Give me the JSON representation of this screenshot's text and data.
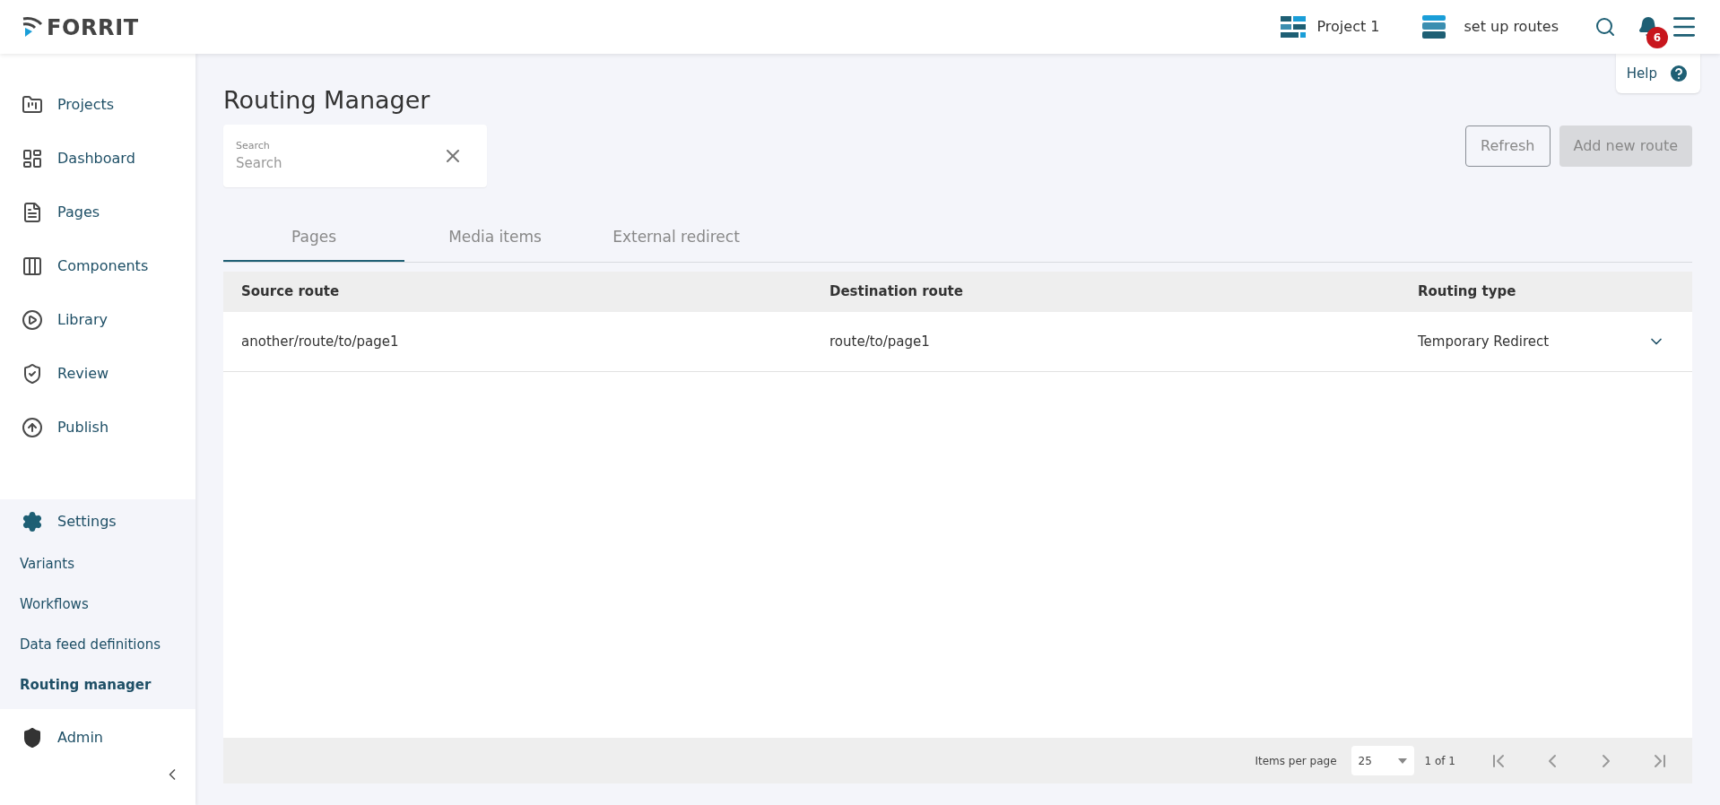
{
  "logo": {
    "text": "FORRIT"
  },
  "header": {
    "project": "Project 1",
    "workflow": "set up routes",
    "notifications": "6"
  },
  "help": {
    "label": "Help"
  },
  "sidebar": {
    "items": [
      {
        "label": "Projects"
      },
      {
        "label": "Dashboard"
      },
      {
        "label": "Pages"
      },
      {
        "label": "Components"
      },
      {
        "label": "Library"
      },
      {
        "label": "Review"
      },
      {
        "label": "Publish"
      }
    ],
    "settings": {
      "label": "Settings",
      "children": [
        {
          "label": "Variants",
          "selected": false
        },
        {
          "label": "Workflows",
          "selected": false
        },
        {
          "label": "Data feed definitions",
          "selected": false
        },
        {
          "label": "Routing manager",
          "selected": true
        }
      ]
    },
    "admin": {
      "label": "Admin"
    }
  },
  "page": {
    "title": "Routing Manager"
  },
  "search": {
    "label": "Search",
    "placeholder": "Search"
  },
  "buttons": [
    {
      "label": "Refresh",
      "disabled": false
    },
    {
      "label": "Add new route",
      "disabled": true
    }
  ],
  "tabs": [
    {
      "label": "Pages",
      "selected": true
    },
    {
      "label": "Media items",
      "selected": false
    },
    {
      "label": "External redirect",
      "selected": false
    }
  ],
  "table": {
    "columns": [
      "Source route",
      "Destination route",
      "Routing type"
    ],
    "rows": [
      {
        "cells": [
          "another/route/to/page1",
          "route/to/page1",
          "Temporary Redirect"
        ],
        "expanded": false
      }
    ]
  },
  "pagination": {
    "items_per_page_label": "Items per page",
    "items_per_page": "25",
    "page_info": "1 of 1"
  }
}
